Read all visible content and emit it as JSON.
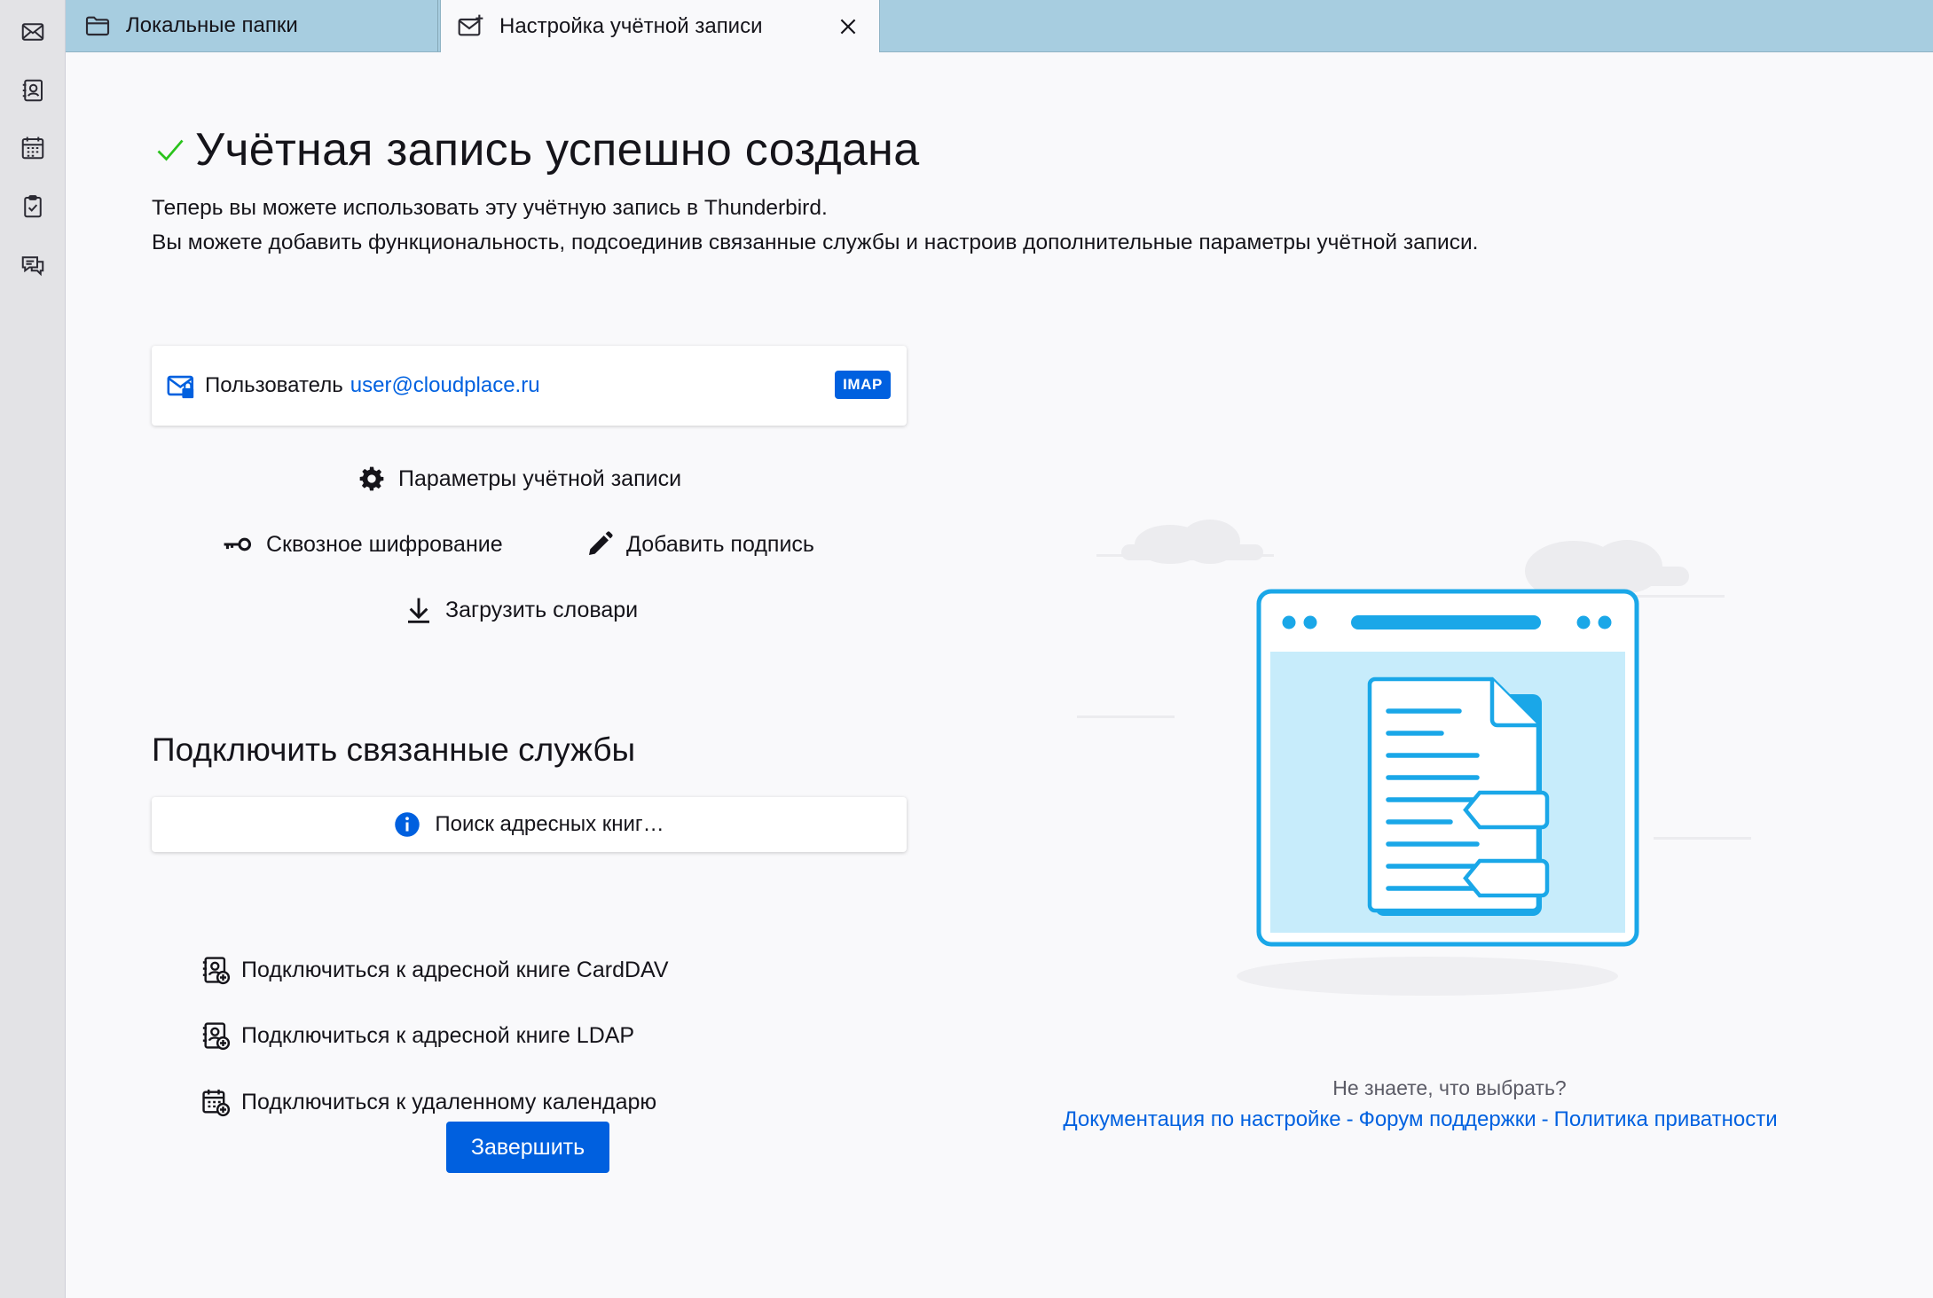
{
  "spaces_toolbar": {
    "items": [
      "mail-space",
      "address-book-space",
      "calendar-space",
      "tasks-space",
      "chat-space"
    ]
  },
  "tabs": [
    {
      "label": "Локальные папки",
      "icon": "folder-icon"
    },
    {
      "label": "Настройка учётной записи",
      "icon": "mail-setup-icon",
      "active": true
    }
  ],
  "page": {
    "title": "Учётная запись успешно создана",
    "description_line1": "Теперь вы можете использовать эту учётную запись в Thunderbird.",
    "description_line2": "Вы можете добавить функциональность, подсоединив связанные службы и настроив дополнительные параметры учётной записи."
  },
  "account": {
    "label": "Пользователь",
    "email": "user@cloudplace.ru",
    "protocol_badge": "IMAP"
  },
  "actions": {
    "account_settings": "Параметры учётной записи",
    "e2e_encryption": "Сквозное шифрование",
    "add_signature": "Добавить подпись",
    "download_dictionaries": "Загрузить словари"
  },
  "services": {
    "title": "Подключить связанные службы",
    "search_address_books": "Поиск адресных книг…",
    "connect_carddav": "Подключиться к адресной книге CardDAV",
    "connect_ldap": "Подключиться к адресной книге LDAP",
    "connect_calendar": "Подключиться к удаленному календарю"
  },
  "finish_button": "Завершить",
  "help": {
    "question": "Не знаете, что выбрать?",
    "docs_link": "Документация по настройке",
    "forum_link": "Форум поддержки",
    "privacy_link": "Политика приватности",
    "separator": "-"
  },
  "colors": {
    "accent": "#0060df",
    "link": "#0061e0",
    "success": "#2ac31c",
    "illustration_blue": "#1aa7e8"
  }
}
